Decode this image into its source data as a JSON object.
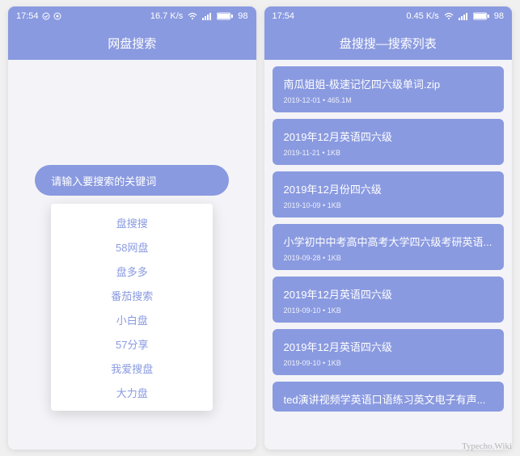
{
  "left": {
    "status": {
      "time": "17:54",
      "net_speed": "16.7 K/s",
      "battery": "98"
    },
    "header": "网盘搜索",
    "search_placeholder": "请输入要搜索的关键词",
    "dropdown": [
      "盘搜搜",
      "58网盘",
      "盘多多",
      "番茄搜索",
      "小白盘",
      "57分享",
      "我爱搜盘",
      "大力盘"
    ]
  },
  "right": {
    "status": {
      "time": "17:54",
      "net_speed": "0.45 K/s",
      "battery": "98"
    },
    "header": "盘搜搜—搜索列表",
    "results": [
      {
        "title": "南瓜姐姐-极速记忆四六级单词.zip",
        "meta": "2019-12-01 • 465.1M"
      },
      {
        "title": "2019年12月英语四六级",
        "meta": "2019-11-21 • 1KB"
      },
      {
        "title": "2019年12月份四六级",
        "meta": "2019-10-09 • 1KB"
      },
      {
        "title": "小学初中中考高中高考大学四六级考研英语...",
        "meta": "2019-09-28 • 1KB"
      },
      {
        "title": "2019年12月英语四六级",
        "meta": "2019-09-10 • 1KB"
      },
      {
        "title": "2019年12月英语四六级",
        "meta": "2019-09-10 • 1KB"
      },
      {
        "title": "ted演讲视频学英语口语练习英文电子有声...",
        "meta": ""
      }
    ]
  },
  "watermark": "Typecho.Wiki"
}
